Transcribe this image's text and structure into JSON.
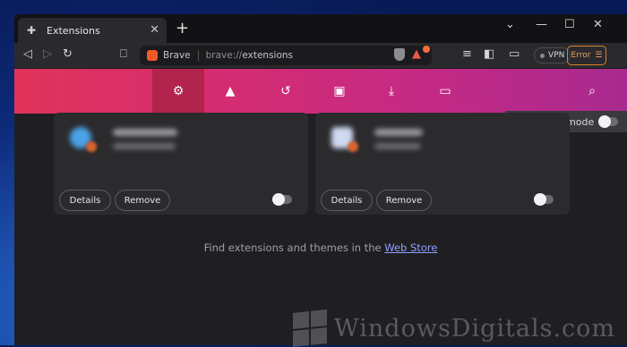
{
  "tab": {
    "title": "Extensions"
  },
  "toolbar": {
    "brand": "Brave",
    "url_scheme": "brave://",
    "url_path": "extensions",
    "vpn_label": "VPN",
    "error_label": "Error"
  },
  "devmode": {
    "label": "Developer mode",
    "enabled": false
  },
  "cards": [
    {
      "details_label": "Details",
      "remove_label": "Remove",
      "enabled": false
    },
    {
      "details_label": "Details",
      "remove_label": "Remove",
      "enabled": false
    }
  ],
  "footer": {
    "text": "Find extensions and themes in the ",
    "link": "Web Store"
  },
  "watermark": {
    "text": "WindowsDigitals.com"
  },
  "colors": {
    "accent": "#d42c72",
    "error": "#d9822b",
    "link": "#8ea0ff"
  }
}
